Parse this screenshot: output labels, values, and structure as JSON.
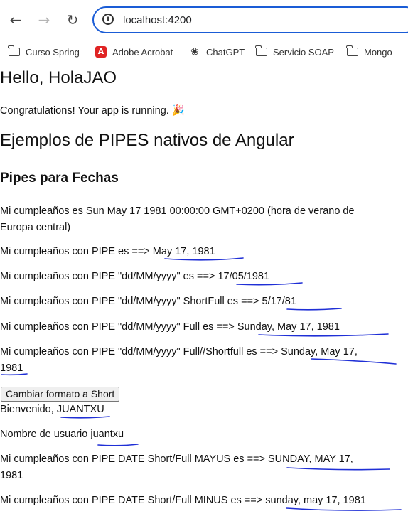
{
  "browser": {
    "url": "localhost:4200",
    "bookmarks": [
      {
        "label": "Curso Spring",
        "icon": "folder-icon"
      },
      {
        "label": "Adobe Acrobat",
        "icon": "acrobat-icon"
      },
      {
        "label": "ChatGPT",
        "icon": "chatgpt-icon"
      },
      {
        "label": "Servicio SOAP",
        "icon": "folder-icon"
      },
      {
        "label": "Mongo",
        "icon": "folder-icon"
      }
    ]
  },
  "page": {
    "hello": "Hello, HolaJAO",
    "congrats": "Congratulations! Your app is running. 🎉",
    "title": "Ejemplos de PIPES nativos de Angular",
    "subtitle": "Pipes para Fechas",
    "birthday_raw_line1": "Mi cumpleaños es Sun May 17 1981 00:00:00 GMT+0200 (hora de verano de",
    "birthday_raw_line2": "Europa central)",
    "pipe_prefix": "Mi cumpleaños con PIPE es ==> ",
    "pipe_value": "May 17, 1981",
    "pipe_dd_prefix": "Mi cumpleaños con PIPE \"dd/MM/yyyy\" es ==> ",
    "pipe_dd_value": "17/05/1981",
    "pipe_short_prefix": "Mi cumpleaños con PIPE \"dd/MM/yyyy\" ShortFull es ==> ",
    "pipe_short_value": "5/17/81",
    "pipe_full_prefix": "Mi cumpleaños con PIPE \"dd/MM/yyyy\" Full es ==> ",
    "pipe_full_value": "Sunday, May 17, 1981",
    "pipe_toggle_prefix": "Mi cumpleaños con PIPE \"dd/MM/yyyy\" Full//Shortfull es ==> ",
    "pipe_toggle_value_line1": "Sunday, May 17,",
    "pipe_toggle_value_line2": "1981",
    "button_label": "Cambiar formato a Short",
    "welcome_prefix": "Bienvenido, ",
    "welcome_value": "JUANTXU",
    "username_prefix": "Nombre de usuario ",
    "username_value": "juantxu",
    "upper_prefix": "Mi cumpleaños con PIPE DATE Short/Full MAYUS es ==> ",
    "upper_value_line1": "SUNDAY, MAY 17,",
    "upper_value_line2": "1981",
    "lower_prefix": "Mi cumpleaños con PIPE DATE Short/Full MINUS es ==> ",
    "lower_value": "sunday, may 17, 1981"
  },
  "colors": {
    "annotation": "#1f2fd6",
    "omnibox_border": "#1a5cd6"
  }
}
